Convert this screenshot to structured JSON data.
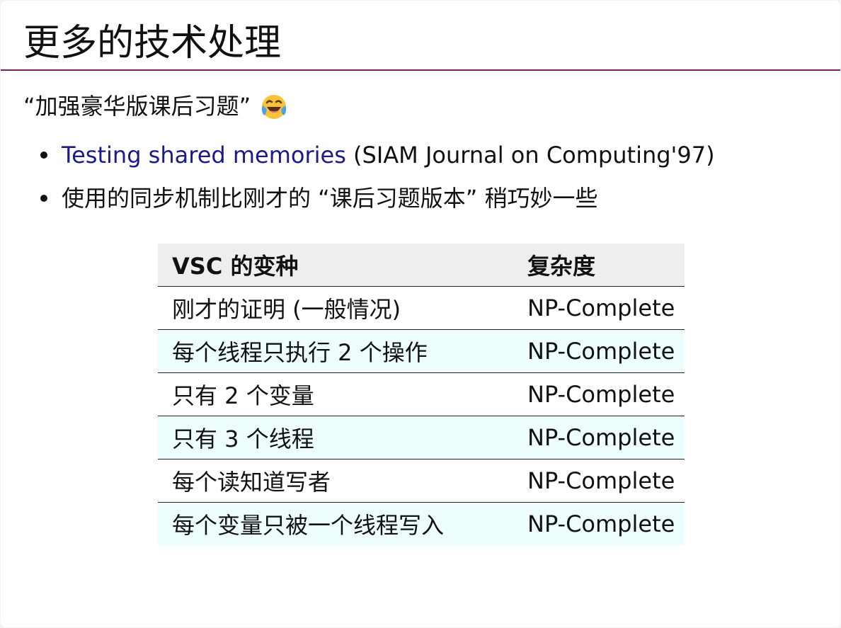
{
  "slide": {
    "title": "更多的技术处理",
    "intro": {
      "text": "“加强豪华版课后习题”",
      "emoji": "face-with-tears-of-joy-icon"
    },
    "bullets": [
      {
        "link_text": "Testing shared memories",
        "rest_text": " (SIAM Journal on Computing'97)"
      },
      {
        "text": "使用的同步机制比刚才的 “课后习题版本” 稍巧妙一些"
      }
    ],
    "table": {
      "headers": [
        "VSC 的变种",
        "复杂度"
      ],
      "rows": [
        [
          "刚才的证明 (一般情况)",
          "NP-Complete"
        ],
        [
          "每个线程只执行 2 个操作",
          "NP-Complete"
        ],
        [
          "只有 2 个变量",
          "NP-Complete"
        ],
        [
          "只有 3 个线程",
          "NP-Complete"
        ],
        [
          "每个读知道写者",
          "NP-Complete"
        ],
        [
          "每个变量只被一个线程写入",
          "NP-Complete"
        ]
      ]
    }
  },
  "colors": {
    "title_rule": "#7a1f6e",
    "link": "#1a1a8c",
    "header_bg": "#eeeeee",
    "alt_row_bg": "#eefefe"
  }
}
